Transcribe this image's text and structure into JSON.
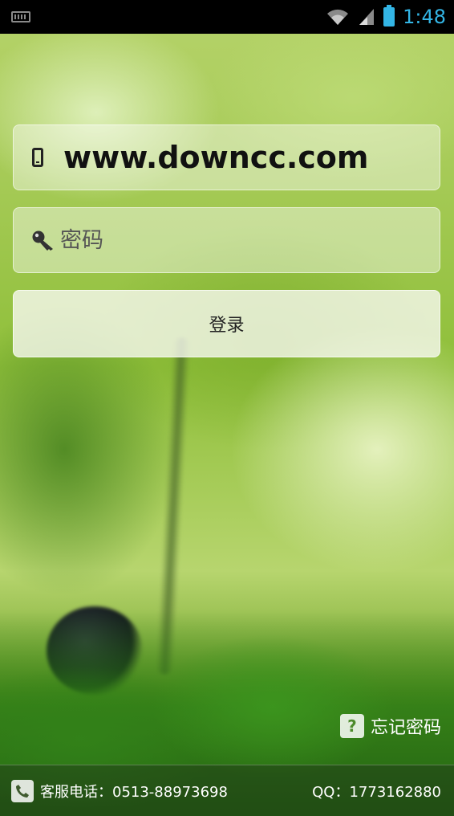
{
  "status_bar": {
    "time": "1:48",
    "icons": [
      "keyboard-icon",
      "wifi-icon",
      "signal-icon",
      "battery-icon"
    ]
  },
  "login": {
    "phone_value": "www.downcc.com",
    "password_placeholder": "密码",
    "login_button": "登录"
  },
  "forgot_password": "忘记密码",
  "footer": {
    "service_phone": "客服电话：0513-88973698",
    "qq": "QQ：1773162880"
  },
  "colors": {
    "status_accent": "#33b5e5",
    "status_bg": "#000000",
    "background_green": "#9cc04a"
  }
}
